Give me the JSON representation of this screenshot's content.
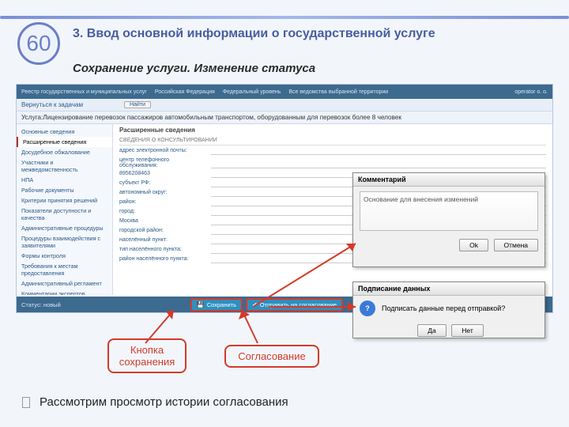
{
  "slide": {
    "number": "60"
  },
  "heading": "3. Ввод основной информации о государственной услуге",
  "subheading": "Сохранение услуги. Изменение статуса",
  "topbar": {
    "logo": "Реестр государственных и муниципальных услуг",
    "region": "Российская Федерация",
    "level": "Федеральный уровень",
    "agency": "Все ведомства выбранной территории",
    "user": "operator о. о."
  },
  "back_link": "Вернуться к задачам",
  "find_label": "Найти",
  "service_title": "Услуга:Лицензирование перевозок пассажиров автомобильным транспортом, оборудованным для перевозок более 8 человек",
  "sidebar": {
    "items": [
      "Основные сведения",
      "Расширенные сведения",
      "Досудебное обжалование",
      "Участники и межведомственность",
      "НПА",
      "Рабочие документы",
      "Критерии принятия решений",
      "Показатели доступности и качества",
      "Административные процедуры",
      "Процедуры взаимодействия с заявителями",
      "Формы контроля",
      "Требования к местам предоставления",
      "Административный регламент",
      "Комментарии экспертов"
    ]
  },
  "main": {
    "title": "Расширенные сведения",
    "section": "СВЕДЕНИЯ О КОНСУЛЬТИРОВАНИИ",
    "fields": [
      {
        "label": "адрес электронной почты:",
        "value": ""
      },
      {
        "label": "центр телефонного обслуживания:",
        "value": ""
      },
      {
        "label": "8956208463",
        "value": ""
      },
      {
        "label": "субъект РФ:",
        "value": ""
      },
      {
        "label": "автономный округ:",
        "value": ""
      },
      {
        "label": "район:",
        "value": ""
      },
      {
        "label": "город:",
        "value": ""
      },
      {
        "label": "Москва",
        "value": ""
      },
      {
        "label": "городской район:",
        "value": ""
      },
      {
        "label": "населённый пункт:",
        "value": ""
      },
      {
        "label": "тип населённого пункта:",
        "value": ""
      },
      {
        "label": "район населённого пункта:",
        "value": ""
      }
    ]
  },
  "statusbar": {
    "status_label": "Статус: новый",
    "save": "Сохранить",
    "send": "Отправить на согласование"
  },
  "dialog_comment": {
    "title": "Комментарий",
    "placeholder": "Основание для внесения изменений",
    "ok": "Ok",
    "cancel": "Отмена"
  },
  "dialog_sign": {
    "title": "Подписание данных",
    "message": "Подписать данные перед отправкой?",
    "yes": "Да",
    "no": "Нет"
  },
  "callouts": {
    "save": "Кнопка сохранения",
    "agree": "Согласование"
  },
  "bullet": "Рассмотрим просмотр истории согласования"
}
